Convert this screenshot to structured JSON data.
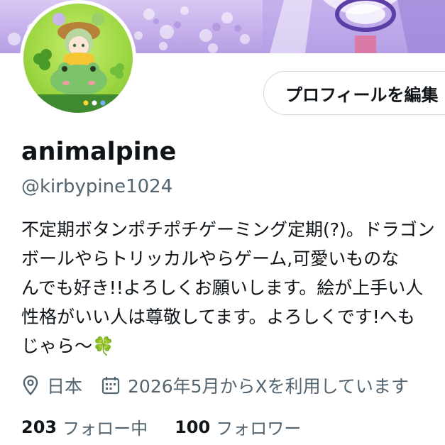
{
  "profile": {
    "edit_button_label": "プロフィールを編集",
    "display_name": "animalpine",
    "handle": "@kirbypine1024",
    "bio_lines": [
      "不定期ボタンポチポチゲーミング定期(?)。ドラゴン",
      "ボールやらトリッカルやらゲーム,可愛いものな",
      "んでも好き!!よろしくお願いします。絵が上手い人",
      "性格がいい人は尊敬してます。よろしくです!へも",
      "じゃら〜🍀"
    ],
    "location": "日本",
    "joined": "2026年5月からXを利用しています",
    "following_count": "203",
    "following_label": "フォロー中",
    "followers_count": "100",
    "followers_label": "フォロワー"
  },
  "icons": {
    "location": "location-pin-icon",
    "joined": "calendar-icon"
  },
  "colors": {
    "text_primary": "#0f1419",
    "text_secondary": "#536471",
    "border": "#cfd9de",
    "banner": "#c6b1ec",
    "avatar_bg": "#9fd844"
  }
}
